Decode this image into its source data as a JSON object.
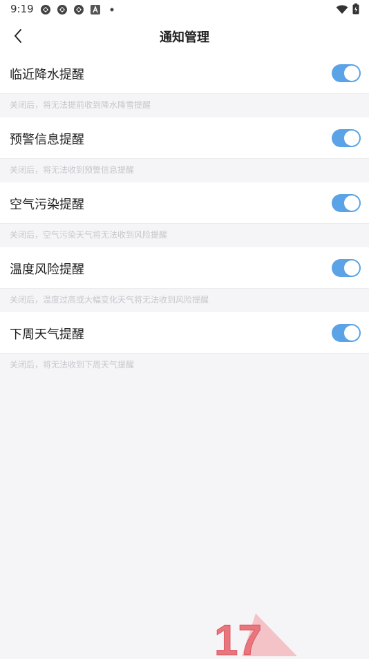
{
  "status": {
    "time": "9:19"
  },
  "nav": {
    "title": "通知管理"
  },
  "settings": [
    {
      "label": "临近降水提醒",
      "description": "关闭后，将无法提前收到降水降雪提醒",
      "enabled": true
    },
    {
      "label": "预警信息提醒",
      "description": "关闭后，将无法收到预警信息提醒",
      "enabled": true
    },
    {
      "label": "空气污染提醒",
      "description": "关闭后，空气污染天气将无法收到风险提醒",
      "enabled": true
    },
    {
      "label": "温度风险提醒",
      "description": "关闭后，温度过高或大幅变化天气将无法收到风险提醒",
      "enabled": true
    },
    {
      "label": "下周天气提醒",
      "description": "关闭后，将无法收到下周天气提醒",
      "enabled": true
    }
  ],
  "colors": {
    "toggle_on": "#5aa3e6",
    "background": "#f5f5f7",
    "desc_text": "#c7c7cc"
  },
  "watermark": {
    "text": "17"
  }
}
